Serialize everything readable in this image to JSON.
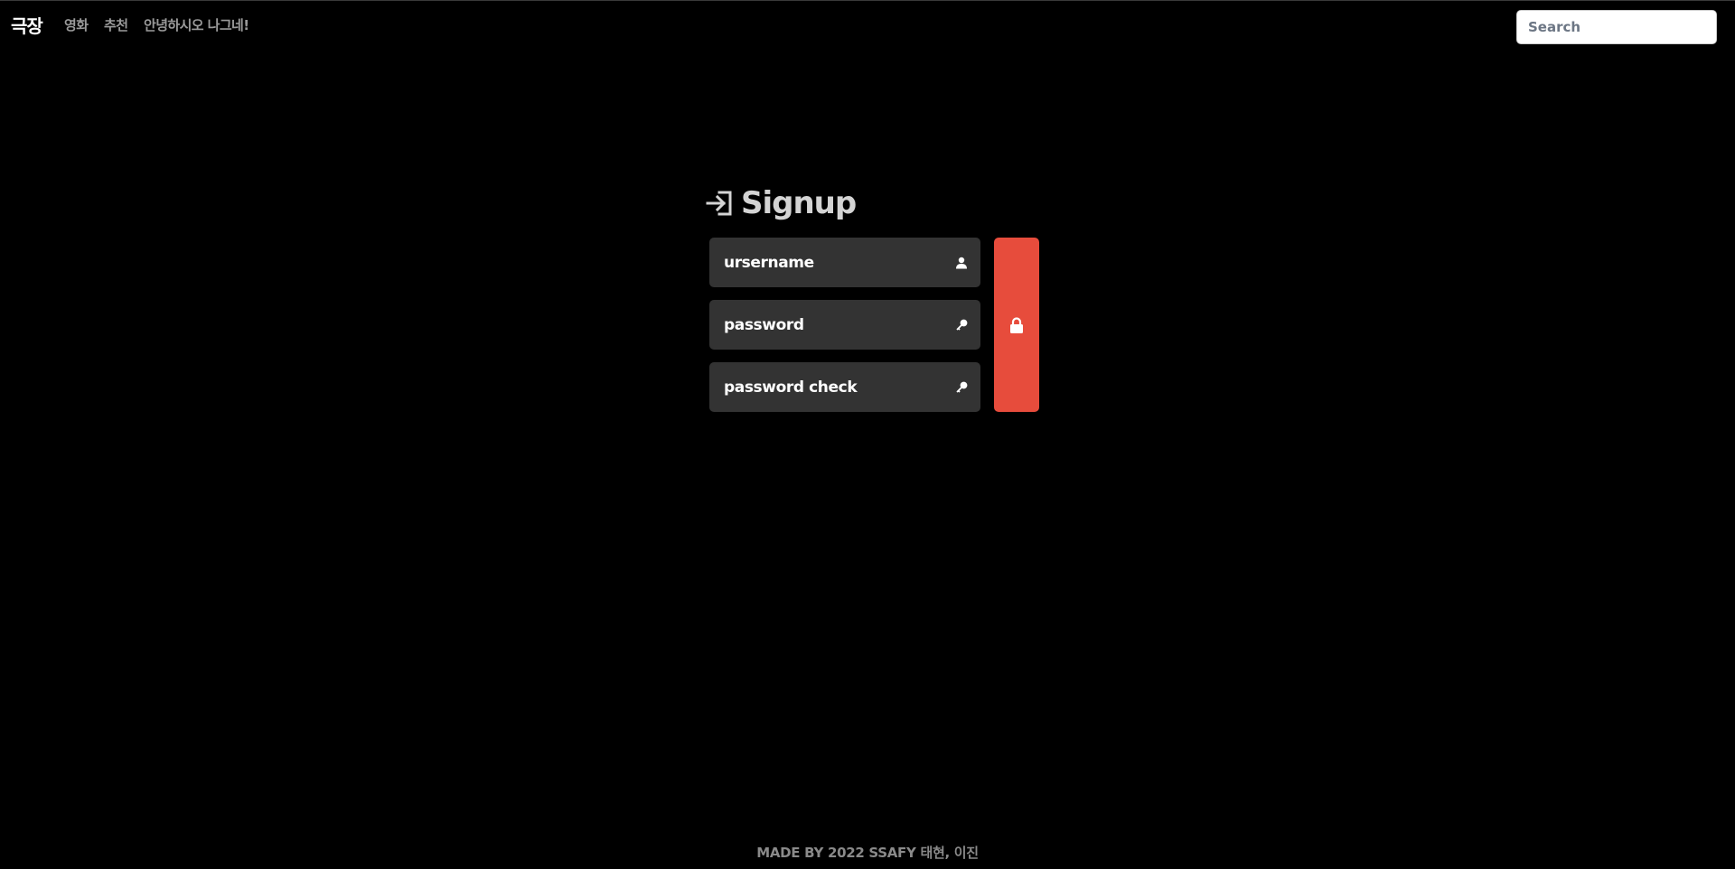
{
  "navbar": {
    "brand": "극장",
    "links": {
      "movie": "영화",
      "recommend": "추천",
      "greeting": "안녕하시오 나그네!"
    },
    "search": {
      "placeholder": "Search"
    }
  },
  "signup": {
    "title": "Signup",
    "title_icon": "sign-in-icon",
    "fields": {
      "username": {
        "placeholder": "ursername",
        "icon": "user-icon"
      },
      "password": {
        "placeholder": "password",
        "icon": "key-icon"
      },
      "password_check": {
        "placeholder": "password check",
        "icon": "key-icon"
      }
    },
    "submit": {
      "icon": "lock-icon"
    }
  },
  "colors": {
    "background": "#000000",
    "field_bg": "#333333",
    "submit_bg": "#e74c3c",
    "title_text": "#d4d4d4",
    "nav_link": "#9a9a9a"
  },
  "footer": {
    "text": "MADE BY 2022 SSAFY 태현, 이진"
  }
}
